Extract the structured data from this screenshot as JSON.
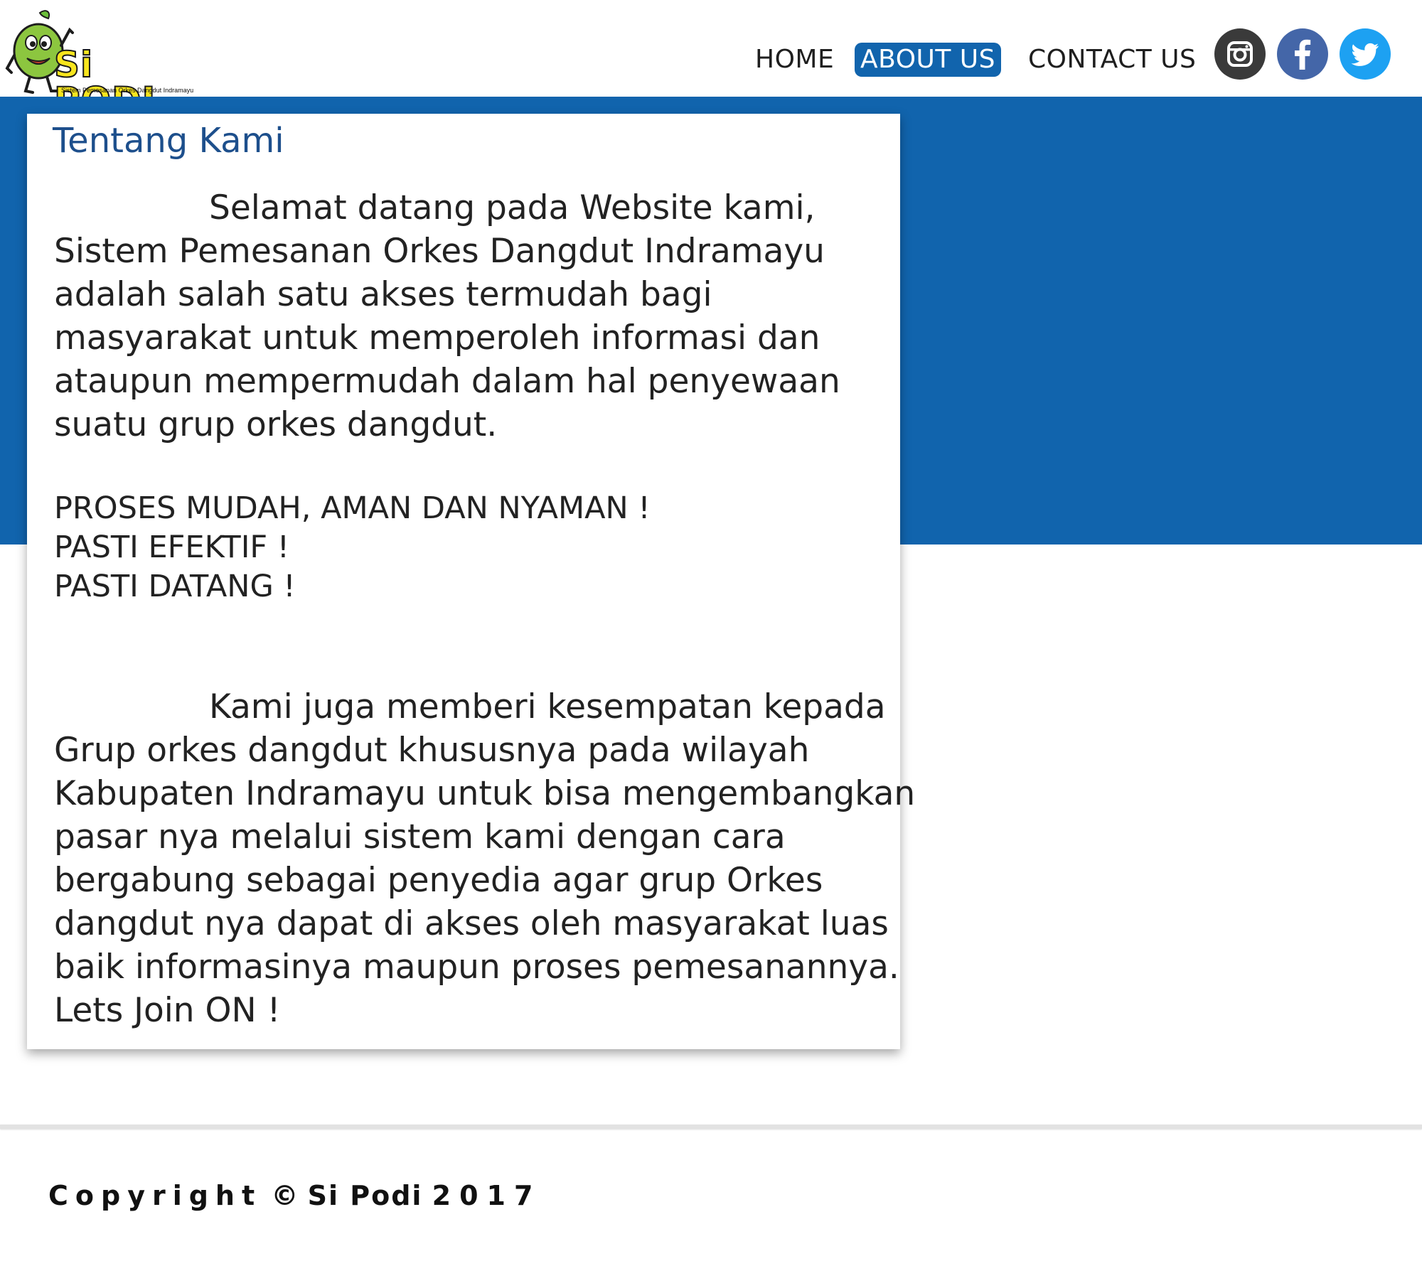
{
  "header": {
    "logo": {
      "title": "Si PODI",
      "subtitle": "Sistem Pemesanan Orkes Dangdut Indramayu"
    },
    "nav": [
      {
        "label": "HOME",
        "active": false
      },
      {
        "label": "ABOUT US",
        "active": true
      },
      {
        "label": "CONTACT US",
        "active": false
      }
    ],
    "social": [
      {
        "name": "instagram-icon",
        "color": "#3a3a3a"
      },
      {
        "name": "facebook-icon",
        "color": "#4466a8"
      },
      {
        "name": "twitter-icon",
        "color": "#1da1f2"
      }
    ]
  },
  "theme": {
    "band_color": "#1164ad",
    "title_color": "#1d4f8c"
  },
  "about": {
    "title": "Tentang Kami",
    "paragraph1": [
      "Selamat datang pada Website kami,",
      "Sistem Pemesanan Orkes Dangdut Indramayu",
      "adalah salah satu akses termudah bagi",
      "masyarakat untuk memperoleh informasi dan",
      "ataupun mempermudah dalam hal penyewaan",
      "suatu grup orkes dangdut."
    ],
    "slogans": [
      "PROSES MUDAH, AMAN DAN NYAMAN !",
      "PASTI EFEKTIF !",
      "PASTI DATANG !"
    ],
    "paragraph2": [
      "Kami juga memberi kesempatan kepada",
      "Grup orkes dangdut khususnya pada wilayah",
      "Kabupaten Indramayu untuk bisa mengembangkan",
      "pasar nya melalui sistem kami dengan cara",
      "bergabung sebagai penyedia agar grup Orkes",
      "dangdut nya dapat di akses oleh masyarakat luas",
      "baik informasinya maupun proses pemesanannya.",
      "Lets Join ON !"
    ]
  },
  "footer": {
    "copyright_word": "Copyright",
    "symbol": "©",
    "brand": "Si Podi",
    "year": "2017"
  }
}
